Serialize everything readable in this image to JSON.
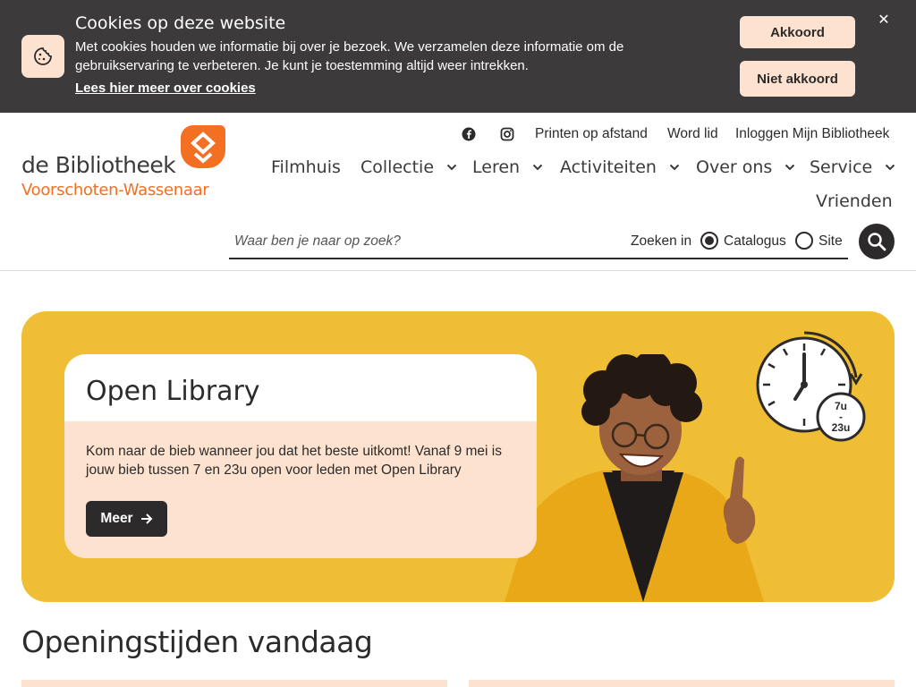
{
  "cookie": {
    "title": "Cookies op deze website",
    "text": "Met cookies houden we informatie bij over je bezoek. We verzamelen deze informatie om de gebruikservaring te verbeteren. Je kunt je toestemming altijd weer intrekken.",
    "link": "Lees hier meer over cookies",
    "accept_label": "Akkoord",
    "decline_label": "Niet akkoord",
    "close_glyph": "✕",
    "icon": "cookie-icon"
  },
  "logo": {
    "main": "de Bibliotheek",
    "sub": "Voorschoten-Wassenaar"
  },
  "utility_nav": {
    "social": [
      "facebook-icon",
      "instagram-icon"
    ],
    "links": [
      "Printen op afstand",
      "Word lid",
      "Inloggen Mijn Bibliotheek"
    ]
  },
  "main_nav": [
    {
      "label": "Filmhuis"
    },
    {
      "label": "Collectie"
    },
    {
      "label": "Leren"
    },
    {
      "label": "Activiteiten"
    },
    {
      "label": "Over ons"
    },
    {
      "label": "Service"
    },
    {
      "label": "Vrienden"
    }
  ],
  "search": {
    "placeholder": "Waar ben je naar op zoek?",
    "scope_label": "Zoeken in",
    "options": [
      "Catalogus",
      "Site"
    ],
    "selected": "Catalogus"
  },
  "hero": {
    "title": "Open Library",
    "text": "Kom naar de bieb wanneer jou dat het beste uitkomt! Vanaf 9 mei is jouw bieb tussen 7 en 23u open voor leden met Open Library",
    "button_label": "Meer",
    "clock_badge": [
      "7u",
      "-",
      "23u"
    ]
  },
  "section": {
    "title": "Openingstijden vandaag"
  },
  "colors": {
    "dark": "#3c3a3b",
    "peach": "#fde3cf",
    "orange": "#f36f21",
    "yellow": "#f0be35"
  }
}
